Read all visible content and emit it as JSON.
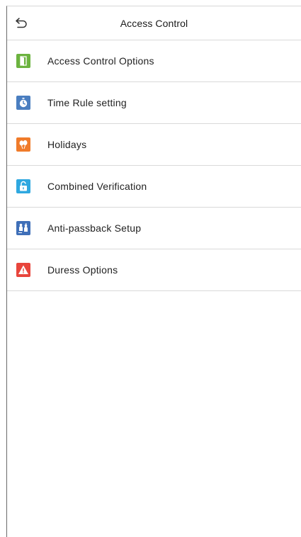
{
  "header": {
    "back_icon": "back-arrow-icon",
    "title": "Access Control"
  },
  "menu": {
    "items": [
      {
        "label": "Access Control Options",
        "icon": "door-icon",
        "color": "#6cb33f"
      },
      {
        "label": "Time Rule setting",
        "icon": "timer-icon",
        "color": "#4a7ec0"
      },
      {
        "label": "Holidays",
        "icon": "balloons-icon",
        "color": "#f07b2a"
      },
      {
        "label": "Combined Verification",
        "icon": "unlock-icon",
        "color": "#2fa8e0"
      },
      {
        "label": "Anti-passback Setup",
        "icon": "anti-passback-icon",
        "color": "#3f6fb8"
      },
      {
        "label": "Duress Options",
        "icon": "warning-icon",
        "color": "#e8453c"
      }
    ]
  }
}
